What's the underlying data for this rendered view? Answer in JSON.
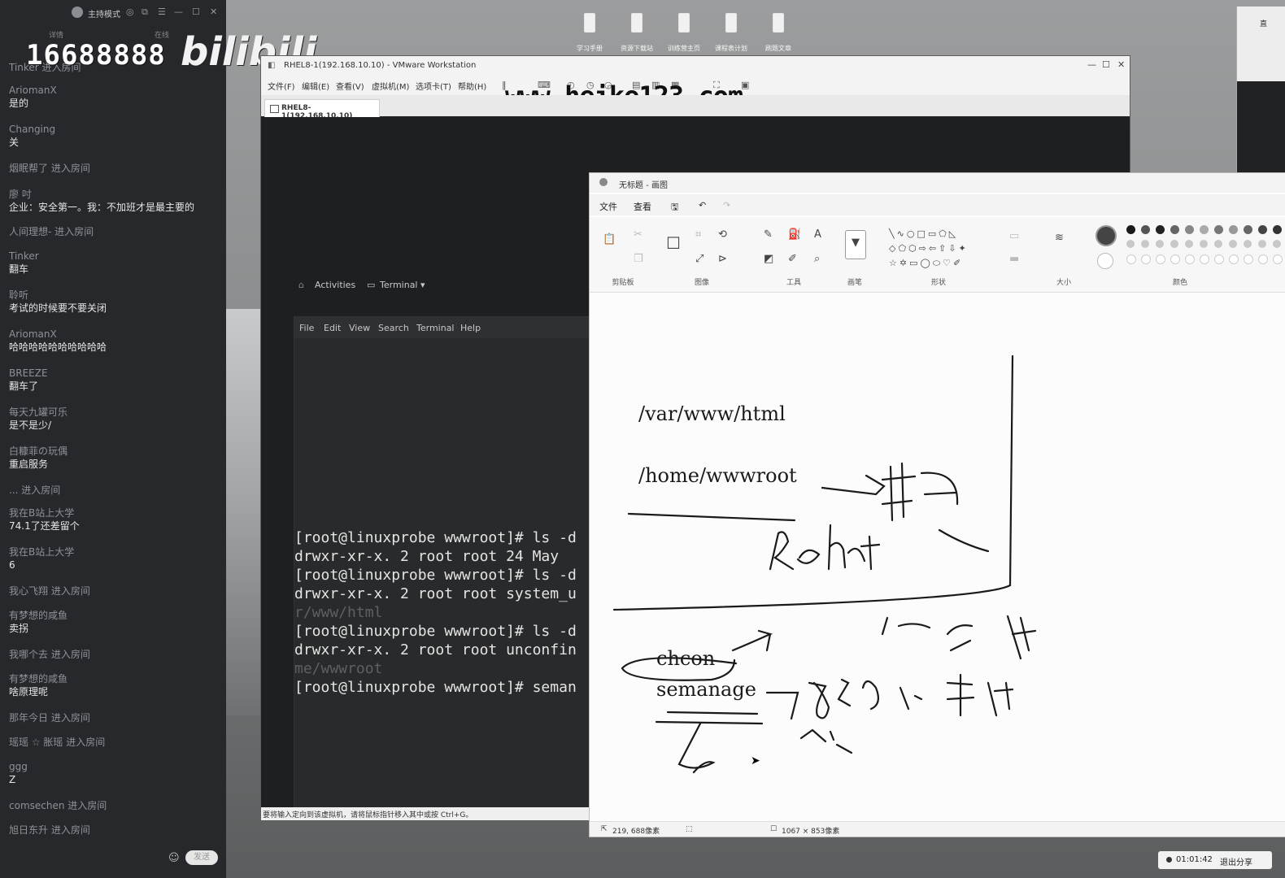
{
  "chat": {
    "header_mode": "主持模式",
    "tab_left": "详情",
    "tab_right": "在线",
    "overlay_number": "16688888",
    "overlay_logo": "bilibili",
    "messages": [
      {
        "user": "Tinker 进入房间",
        "text": ""
      },
      {
        "user": "AriomanX",
        "text": "是的"
      },
      {
        "user": "Changing",
        "text": "关"
      },
      {
        "user": "烟眠帮了 进入房间",
        "text": ""
      },
      {
        "user": "廖 吋",
        "text": "企业：安全第一。我：不加班才是最主要的"
      },
      {
        "user": "人间理想- 进入房间",
        "text": ""
      },
      {
        "user": "Tinker",
        "text": "翻车"
      },
      {
        "user": "聆听",
        "text": "考试的时候要不要关闭"
      },
      {
        "user": "AriomanX",
        "text": "哈哈哈哈哈哈哈哈哈哈"
      },
      {
        "user": "BREEZE",
        "text": "翻车了"
      },
      {
        "user": "每天九罐可乐",
        "text": "是不是少/"
      },
      {
        "user": "白糠菲の玩偶",
        "text": "重启服务"
      },
      {
        "user": "... 进入房间",
        "text": ""
      },
      {
        "user": "我在B站上大学",
        "text": "74.1了还差留个"
      },
      {
        "user": "我在B站上大学",
        "text": "6"
      },
      {
        "user": "我心飞翔 进入房间",
        "text": ""
      },
      {
        "user": "有梦想的咸鱼",
        "text": "卖拐"
      },
      {
        "user": "我哪个去 进入房间",
        "text": ""
      },
      {
        "user": "有梦想的咸鱼",
        "text": "啥原理呢"
      },
      {
        "user": "那年今日 进入房间",
        "text": ""
      },
      {
        "user": "瑶瑶 ☆ 胀瑶 进入房间",
        "text": ""
      },
      {
        "user": "ggg",
        "text": "Z"
      },
      {
        "user": "comsechen 进入房间",
        "text": ""
      },
      {
        "user": "旭日东升 进入房间",
        "text": ""
      }
    ],
    "send_label": "发送"
  },
  "taskbar_icons": [
    "学习手册",
    "资源下载站",
    "训练营主页",
    "课程表计划",
    "刷题文章"
  ],
  "vmware": {
    "title": "RHEL8-1(192.168.10.10) - VMware Workstation",
    "menu": [
      "文件(F)",
      "编辑(E)",
      "查看(V)",
      "虚拟机(M)",
      "选项卡(T)",
      "帮助(H)"
    ],
    "tab": "RHEL8-1(192.168.10.10)",
    "watermark": "www.heike123.com",
    "status": "要将输入定向到该虚拟机，请将鼠标指针移入其中或按 Ctrl+G。",
    "gnome": {
      "activities": "Activities",
      "terminal": "Terminal ▾"
    },
    "terminal_menu": [
      "File",
      "Edit",
      "View",
      "Search",
      "Terminal",
      "Help"
    ],
    "terminal_lines": [
      {
        "text": "[root@linuxprobe wwwroot]# ls -d",
        "dim": false
      },
      {
        "text": "drwxr-xr-x. 2 root root 24 May",
        "dim": false
      },
      {
        "text": "[root@linuxprobe wwwroot]# ls -d",
        "dim": false
      },
      {
        "text": "drwxr-xr-x. 2 root root system_u",
        "dim": false
      },
      {
        "text": "r/www/html",
        "dim": true
      },
      {
        "text": "[root@linuxprobe wwwroot]# ls -d",
        "dim": false
      },
      {
        "text": "drwxr-xr-x. 2 root root unconfin",
        "dim": false
      },
      {
        "text": "me/wwwroot",
        "dim": true
      },
      {
        "text": "[root@linuxprobe wwwroot]# seman",
        "dim": false
      }
    ]
  },
  "paint": {
    "title": "无标题 - 画图",
    "menu": [
      "文件",
      "查看"
    ],
    "groups": [
      "剪贴板",
      "图像",
      "工具",
      "画笔",
      "形状",
      "大小",
      "颜色"
    ],
    "canvas_text": {
      "path1": "/var/www/html",
      "path2": "/home/wwwroot",
      "cmd1": "chcon",
      "cmd2": "semanage",
      "hand_redhat": "Redhat"
    },
    "status_pos": "219, 688像素",
    "status_size": "1067 × 853像素",
    "colors": [
      "#1a1a1a",
      "#555555",
      "#222222",
      "#666666",
      "#888888",
      "#aaaaaa",
      "#777777",
      "#999999",
      "#666666",
      "#444444",
      "#333333",
      "#aaaaaa"
    ]
  },
  "rightwin": {
    "title": "直"
  },
  "share": {
    "time": "01:01:42",
    "exit": "退出分享"
  }
}
